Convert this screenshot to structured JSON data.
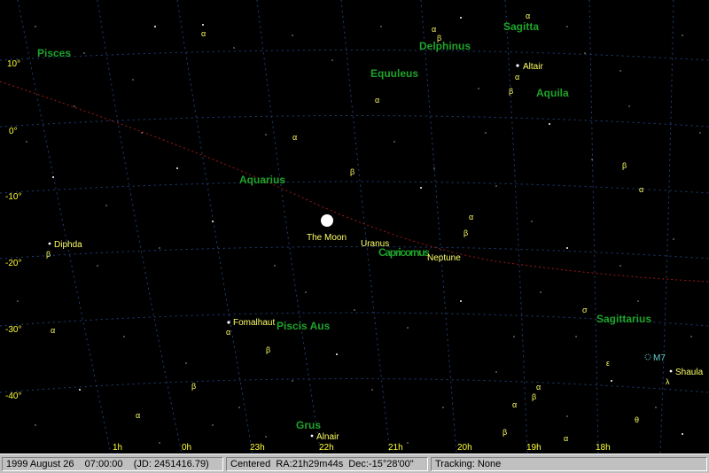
{
  "colors": {
    "background": "#000000",
    "grid": "#1f3f7a",
    "ecliptic": "#a01818",
    "constellation_label": "#1ea32a",
    "star_label": "#ffff66",
    "axis_label": "#ffff33",
    "star": "#ffffff",
    "cluster": "#66cccc"
  },
  "axis": {
    "dec_labels": [
      "10°",
      "0°",
      "-10°",
      "-20°",
      "-30°",
      "-40°"
    ],
    "ra_labels": [
      "1h",
      "0h",
      "23h",
      "22h",
      "21h",
      "20h",
      "19h",
      "18h"
    ]
  },
  "constellations": [
    "Pisces",
    "Delphinus",
    "Sagitta",
    "Equuleus",
    "Aquila",
    "Aquarius",
    "Capricornus",
    "Sagittarius",
    "Piscis Aus",
    "Grus"
  ],
  "named_objects": [
    "Altair",
    "Diphda",
    "The Moon",
    "Uranus",
    "Neptune",
    "Fomalhaut",
    "M7",
    "Shaula",
    "Alnair"
  ],
  "greek_labels": [
    "α",
    "β",
    "σ",
    "ε",
    "λ",
    "θ"
  ],
  "status": {
    "datetime": "1999 August 26    07:00:00    (JD: 2451416.79)",
    "centered": "Centered  RA:21h29m44s  Dec:-15°28'00\"",
    "tracking": "Tracking: None"
  }
}
